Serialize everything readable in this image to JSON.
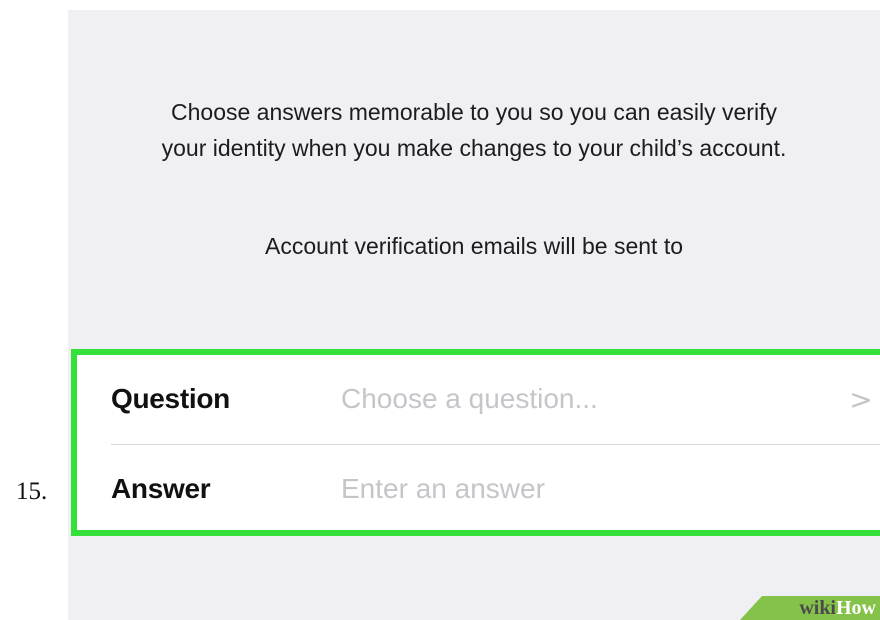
{
  "step": {
    "number": "15."
  },
  "screen": {
    "intro_line1": "Choose answers memorable to you so you can easily verify",
    "intro_line2": "your identity when you make changes to your child’s account.",
    "notice": "Account verification emails will be sent to"
  },
  "form": {
    "highlight_color": "#36e03a",
    "question": {
      "label": "Question",
      "placeholder": "Choose a question...",
      "chevron": ">"
    },
    "answer": {
      "label": "Answer",
      "placeholder": "Enter an answer"
    }
  },
  "watermark": {
    "wiki": "wiki",
    "how": "How"
  }
}
